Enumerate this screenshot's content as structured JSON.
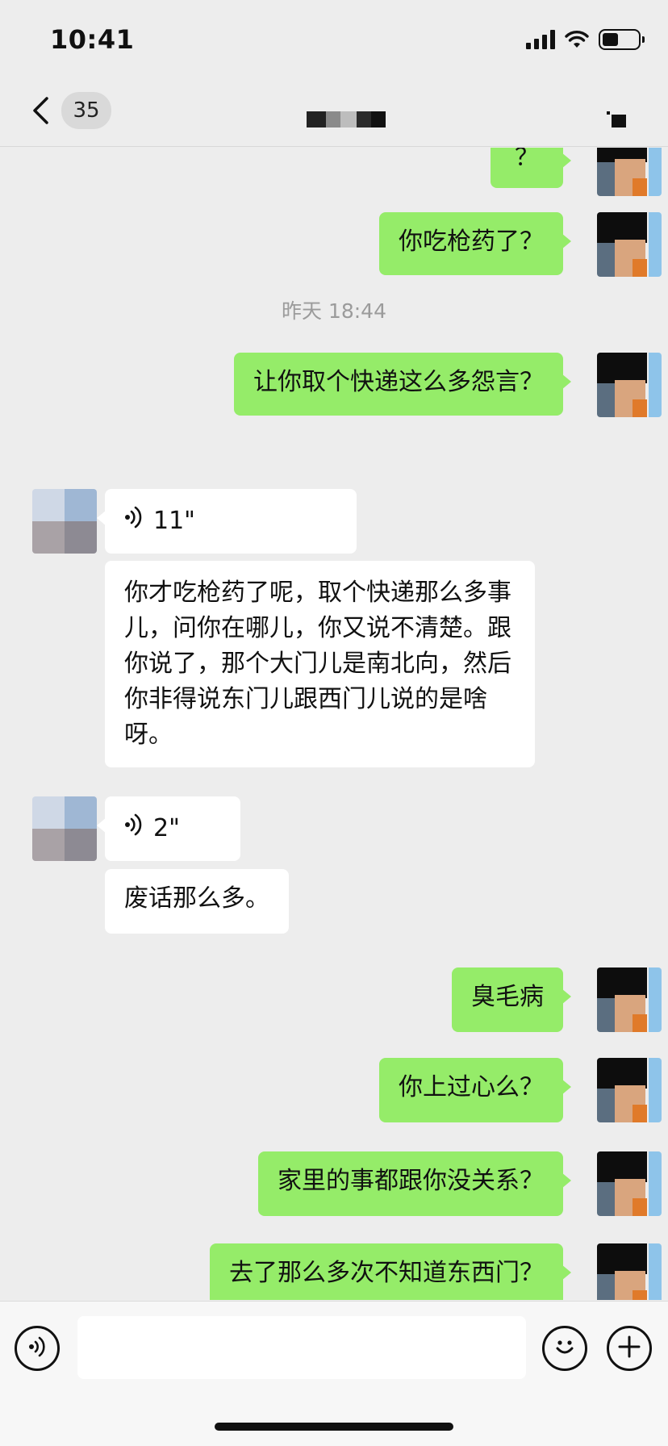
{
  "status_bar": {
    "time": "10:41",
    "signal_icon": "signal-bars-icon",
    "wifi_icon": "wifi-icon",
    "battery_icon": "battery-icon",
    "battery_level": 0.45
  },
  "nav": {
    "back_icon": "chevron-left-icon",
    "unread_count": "35",
    "title_redacted": true,
    "more_icon": "more-icon"
  },
  "chat": {
    "messages": [
      {
        "from": "me",
        "type": "text",
        "text": "？"
      },
      {
        "from": "me",
        "type": "text",
        "text": "你吃枪药了？"
      },
      {
        "type": "timestamp",
        "text": "昨天 18:44"
      },
      {
        "from": "me",
        "type": "text",
        "text": "让你取个快递这么多怨言？"
      },
      {
        "from": "them",
        "type": "voice",
        "duration": "11\""
      },
      {
        "from": "them",
        "type": "text",
        "text": "你才吃枪药了呢，取个快递那么多事儿，问你在哪儿，你又说不清楚。跟你说了，那个大门儿是南北向，然后你非得说东门儿跟西门儿说的是啥呀。"
      },
      {
        "from": "them",
        "type": "voice",
        "duration": "2\""
      },
      {
        "from": "them",
        "type": "text",
        "text": "废话那么多。"
      },
      {
        "from": "me",
        "type": "text",
        "text": "臭毛病"
      },
      {
        "from": "me",
        "type": "text",
        "text": "你上过心么？"
      },
      {
        "from": "me",
        "type": "text",
        "text": "家里的事都跟你没关系？"
      },
      {
        "from": "me",
        "type": "text",
        "text": "去了那么多次不知道东西门？"
      }
    ]
  },
  "input_bar": {
    "voice_icon": "voice-input-icon",
    "input_value": "",
    "emoji_icon": "emoji-icon",
    "plus_icon": "plus-icon"
  },
  "colors": {
    "background": "#ededed",
    "my_bubble": "#95ec69",
    "their_bubble": "#ffffff",
    "timestamp": "#9b9b9b"
  }
}
